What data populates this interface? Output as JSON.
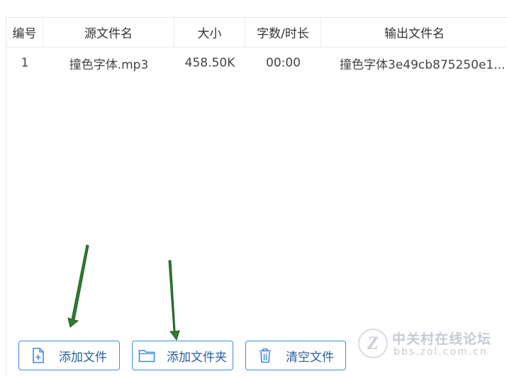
{
  "table": {
    "columns": [
      "编号",
      "源文件名",
      "大小",
      "字数/时长",
      "输出文件名"
    ],
    "rows": [
      [
        "1",
        "撞色字体.mp3",
        "458.50K",
        "00:00",
        "撞色字体3e49cb875250e1..."
      ]
    ]
  },
  "buttons": {
    "add_file": "添加文件",
    "add_folder": "添加文件夹",
    "clear_files": "清空文件"
  },
  "icons": {
    "add_file": "file-plus-icon",
    "add_folder": "folder-icon",
    "clear_files": "trash-icon"
  },
  "watermark": {
    "title": "中关村在线论坛",
    "url": "bbs.zol.com.cn",
    "logo_letter": "Z"
  },
  "colors": {
    "accent": "#3d8be0",
    "button_text": "#2c5f9e",
    "arrow": "#2e7d32"
  }
}
